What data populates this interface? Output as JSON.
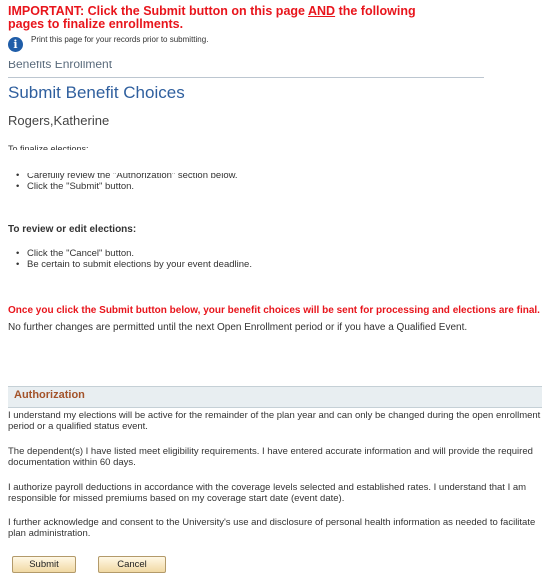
{
  "notice": {
    "line1_pre": "IMPORTANT: Click the Submit button on this page ",
    "line1_and": "AND",
    "line1_post": " the following",
    "line2": "pages to finalize enrollments.",
    "info_icon": "info-icon",
    "print_text": "Print this page for your records prior to submitting."
  },
  "breadcrumb": "Benefits Enrollment",
  "page_title": "Submit Benefit Choices",
  "employee_name": "Rogers,Katherine",
  "finalize_heading": "To finalize elections:",
  "finalize_steps": [
    "Carefully review the \"Authorization\" section below.",
    "Click the \"Submit\" button."
  ],
  "review_heading": "To review or edit elections:",
  "review_steps": [
    "Click the \"Cancel\" button.",
    "Be certain to submit elections by your event deadline."
  ],
  "warning": {
    "red_text": "Once you click the Submit button below, your benefit choices will be sent for processing and elections are final.",
    "rest_text": " No further changes are permitted until the next Open Enrollment period or if you have a Qualified Event."
  },
  "authorization": {
    "title": "Authorization",
    "paragraphs": [
      "I understand my elections will be active for the remainder of the plan year and can only be changed during the open enrollment period or a qualified status event.",
      "The dependent(s) I have listed meet eligibility requirements. I have entered accurate information and will provide the required documentation within 60 days.",
      "I authorize payroll deductions in accordance with the coverage levels selected and established rates. I understand that I am responsible for missed premiums based on my coverage start date (event date).",
      "I further acknowledge and consent to the University's use and disclosure of personal health information as needed to facilitate plan administration."
    ]
  },
  "buttons": {
    "submit": "Submit",
    "cancel": "Cancel"
  },
  "colors": {
    "important_red": "#e8151c",
    "title_blue": "#2f5f9e",
    "auth_title": "#a3532a"
  }
}
